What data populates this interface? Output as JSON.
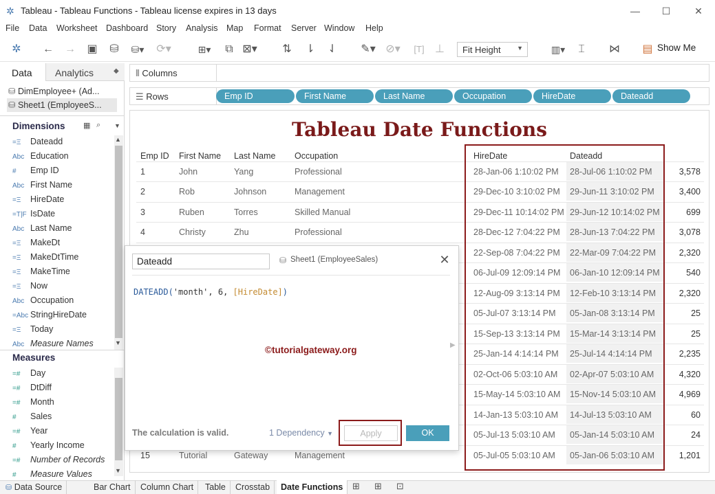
{
  "window": {
    "title": "Tableau - Tableau Functions - Tableau license expires in 13 days"
  },
  "menu": [
    "File",
    "Data",
    "Worksheet",
    "Dashboard",
    "Story",
    "Analysis",
    "Map",
    "Format",
    "Server",
    "Window",
    "Help"
  ],
  "toolbar": {
    "fit": "Fit Height",
    "show_me": "Show Me"
  },
  "left_panel": {
    "tabs": {
      "data": "Data",
      "analytics": "Analytics"
    },
    "sources": [
      "DimEmployee+ (Ad...",
      "Sheet1 (EmployeeS..."
    ],
    "dimensions_header": "Dimensions",
    "dimensions": [
      {
        "icon": "=Ξ",
        "label": "Dateadd"
      },
      {
        "icon": "Abc",
        "label": "Education"
      },
      {
        "icon": "#",
        "label": "Emp ID"
      },
      {
        "icon": "Abc",
        "label": "First Name"
      },
      {
        "icon": "=Ξ",
        "label": "HireDate"
      },
      {
        "icon": "=T|F",
        "label": "IsDate"
      },
      {
        "icon": "Abc",
        "label": "Last Name"
      },
      {
        "icon": "=Ξ",
        "label": "MakeDt"
      },
      {
        "icon": "=Ξ",
        "label": "MakeDtTime"
      },
      {
        "icon": "=Ξ",
        "label": "MakeTime"
      },
      {
        "icon": "=Ξ",
        "label": "Now"
      },
      {
        "icon": "Abc",
        "label": "Occupation"
      },
      {
        "icon": "=Abc",
        "label": "StringHireDate"
      },
      {
        "icon": "=Ξ",
        "label": "Today"
      },
      {
        "icon": "Abc",
        "label": "Measure Names"
      }
    ],
    "measures_header": "Measures",
    "measures": [
      {
        "icon": "=#",
        "label": "Day"
      },
      {
        "icon": "=#",
        "label": "DtDiff"
      },
      {
        "icon": "=#",
        "label": "Month"
      },
      {
        "icon": "#",
        "label": "Sales"
      },
      {
        "icon": "=#",
        "label": "Year"
      },
      {
        "icon": "#",
        "label": "Yearly Income"
      },
      {
        "icon": "=#",
        "label": "Number of Records"
      },
      {
        "icon": "#",
        "label": "Measure Values"
      }
    ]
  },
  "shelves": {
    "columns_label": "Columns",
    "rows_label": "Rows",
    "rows_pills": [
      "Emp ID",
      "First Name",
      "Last Name",
      "Occupation",
      "HireDate",
      "Dateadd"
    ]
  },
  "view": {
    "title": "Tableau Date Functions",
    "headers": [
      "Emp ID",
      "First Name",
      "Last Name",
      "Occupation",
      "HireDate",
      "Dateadd"
    ],
    "rows": [
      {
        "id": "1",
        "first": "John",
        "last": "Yang",
        "occ": "Professional",
        "hire": "28-Jan-06 1:10:02 PM",
        "add": "28-Jul-06 1:10:02 PM",
        "val": "3,578"
      },
      {
        "id": "2",
        "first": "Rob",
        "last": "Johnson",
        "occ": "Management",
        "hire": "29-Dec-10 3:10:02 PM",
        "add": "29-Jun-11 3:10:02 PM",
        "val": "3,400"
      },
      {
        "id": "3",
        "first": "Ruben",
        "last": "Torres",
        "occ": "Skilled Manual",
        "hire": "29-Dec-11 10:14:02 PM",
        "add": "29-Jun-12 10:14:02 PM",
        "val": "699"
      },
      {
        "id": "4",
        "first": "Christy",
        "last": "Zhu",
        "occ": "Professional",
        "hire": "28-Dec-12 7:04:22 PM",
        "add": "28-Jun-13 7:04:22 PM",
        "val": "3,078"
      },
      {
        "id": "",
        "first": "",
        "last": "",
        "occ": "",
        "hire": "22-Sep-08 7:04:22 PM",
        "add": "22-Mar-09 7:04:22 PM",
        "val": "2,320"
      },
      {
        "id": "",
        "first": "",
        "last": "",
        "occ": "",
        "hire": "06-Jul-09 12:09:14 PM",
        "add": "06-Jan-10 12:09:14 PM",
        "val": "540"
      },
      {
        "id": "",
        "first": "",
        "last": "",
        "occ": "",
        "hire": "12-Aug-09 3:13:14 PM",
        "add": "12-Feb-10 3:13:14 PM",
        "val": "2,320"
      },
      {
        "id": "",
        "first": "",
        "last": "",
        "occ": "",
        "hire": "05-Jul-07 3:13:14 PM",
        "add": "05-Jan-08 3:13:14 PM",
        "val": "25"
      },
      {
        "id": "",
        "first": "",
        "last": "",
        "occ": "",
        "hire": "15-Sep-13 3:13:14 PM",
        "add": "15-Mar-14 3:13:14 PM",
        "val": "25"
      },
      {
        "id": "",
        "first": "",
        "last": "",
        "occ": "",
        "hire": "25-Jan-14 4:14:14 PM",
        "add": "25-Jul-14 4:14:14 PM",
        "val": "2,235"
      },
      {
        "id": "",
        "first": "",
        "last": "",
        "occ": "",
        "hire": "02-Oct-06 5:03:10 AM",
        "add": "02-Apr-07 5:03:10 AM",
        "val": "4,320"
      },
      {
        "id": "",
        "first": "",
        "last": "",
        "occ": "",
        "hire": "15-May-14 5:03:10 AM",
        "add": "15-Nov-14 5:03:10 AM",
        "val": "4,969"
      },
      {
        "id": "",
        "first": "",
        "last": "",
        "occ": "",
        "hire": "14-Jan-13 5:03:10 AM",
        "add": "14-Jul-13 5:03:10 AM",
        "val": "60"
      },
      {
        "id": "",
        "first": "",
        "last": "",
        "occ": "",
        "hire": "05-Jul-13 5:03:10 AM",
        "add": "05-Jan-14 5:03:10 AM",
        "val": "24"
      },
      {
        "id": "15",
        "first": "Tutorial",
        "last": "Gateway",
        "occ": "Management",
        "hire": "05-Jul-05 5:03:10 AM",
        "add": "05-Jan-06 5:03:10 AM",
        "val": "1,201"
      }
    ]
  },
  "dialog": {
    "name": "Dateadd",
    "source": "Sheet1 (EmployeeSales)",
    "formula": {
      "fn": "DATEADD(",
      "arg1": "'month'",
      "sep1": ", ",
      "arg2": "6",
      "sep2": ", ",
      "field": "[HireDate]",
      "close": ")"
    },
    "watermark": "©tutorialgateway.org",
    "status": "The calculation is valid.",
    "dependency": "1 Dependency",
    "apply": "Apply",
    "ok": "OK"
  },
  "bottom_tabs": [
    "Data Source",
    "Bar Chart",
    "Column Chart",
    "Table",
    "Crosstab",
    "Date Functions"
  ],
  "colors": {
    "pill": "#4a9fba",
    "highlight": "#8b1a1a",
    "title": "#7a1a1a"
  }
}
